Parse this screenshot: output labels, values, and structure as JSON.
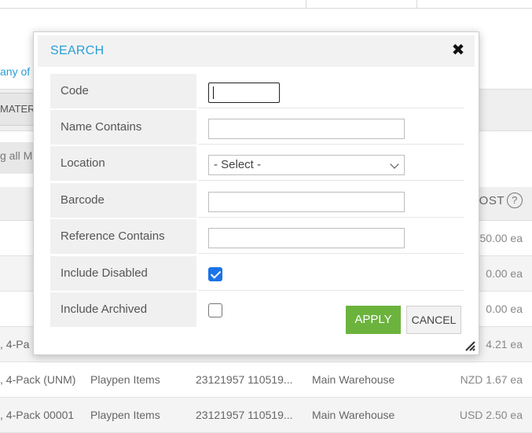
{
  "background": {
    "link_fragment": "any of",
    "tab_fragment": "MATERI",
    "showing_fragment": "g all M",
    "cost_header": "COST",
    "rows": [
      {
        "item": "",
        "group": "",
        "barcode": "",
        "location": "",
        "cost": "50.00 ea"
      },
      {
        "item": "",
        "group": "",
        "barcode": "",
        "location": "",
        "cost": "0.00 ea"
      },
      {
        "item": "",
        "group": "",
        "barcode": "",
        "location": "",
        "cost": "0.00 ea"
      },
      {
        "item": ", 4-Pa",
        "group": "",
        "barcode": "",
        "location": "",
        "cost": "4.21 ea"
      },
      {
        "item": ", 4-Pack (UNM)",
        "group": "Playpen Items",
        "barcode": "23121957 110519...",
        "location": "Main Warehouse",
        "cost": "NZD 1.67 ea"
      },
      {
        "item": ", 4-Pack 00001",
        "group": "Playpen Items",
        "barcode": "23121957 110519...",
        "location": "Main Warehouse",
        "cost": "USD 2.50 ea"
      }
    ]
  },
  "dialog": {
    "title": "SEARCH",
    "fields": {
      "code": {
        "label": "Code",
        "value": ""
      },
      "name_contains": {
        "label": "Name Contains",
        "value": ""
      },
      "location": {
        "label": "Location",
        "selected": "- Select -"
      },
      "barcode": {
        "label": "Barcode",
        "value": ""
      },
      "reference_contains": {
        "label": "Reference Contains",
        "value": ""
      },
      "include_disabled": {
        "label": "Include Disabled",
        "checked": true
      },
      "include_archived": {
        "label": "Include Archived",
        "checked": false
      }
    },
    "apply_label": "APPLY",
    "cancel_label": "CANCEL"
  },
  "colors": {
    "title": "#2a9fd6",
    "apply": "#6cb33e",
    "checkbox": "#1a73e8"
  },
  "icons": [
    "close-icon",
    "chevron-down-icon",
    "help-icon",
    "resize-handle-icon"
  ]
}
